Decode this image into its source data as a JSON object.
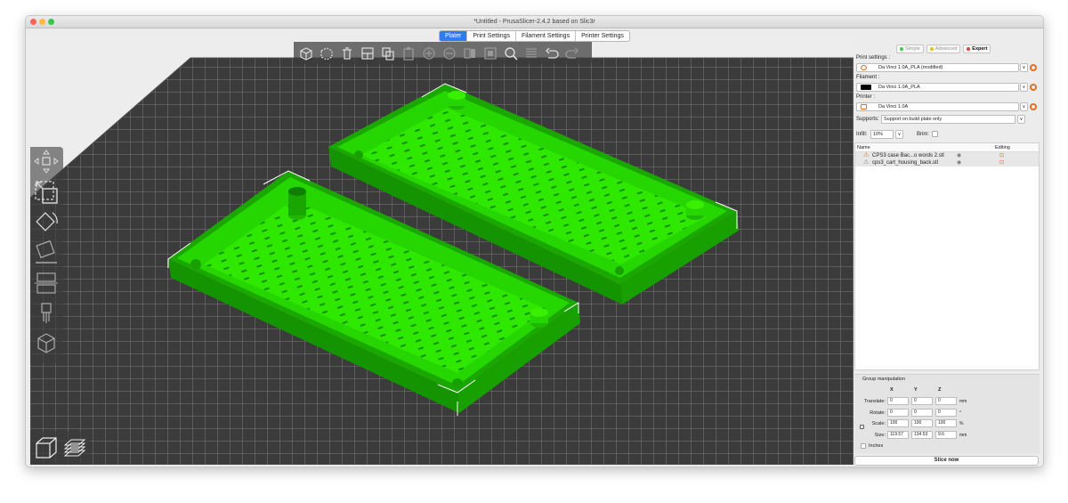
{
  "window": {
    "title": "*Untitled - PrusaSlicer-2.4.2 based on Slic3r"
  },
  "tabs": [
    "Plater",
    "Print Settings",
    "Filament Settings",
    "Printer Settings"
  ],
  "modes": {
    "simple": "Simple",
    "advanced": "Advanced",
    "expert": "Expert"
  },
  "print_settings": {
    "label": "Print settings :",
    "value": "Da Vinci 1.0A_PLA (modified)"
  },
  "filament": {
    "label": "Filament :",
    "value": "Da Vinci 1.0A_PLA"
  },
  "printer": {
    "label": "Printer :",
    "value": "Da Vinci 1.0A"
  },
  "supports": {
    "label": "Supports:",
    "value": "Support on build plate only"
  },
  "infill": {
    "label": "Infill:",
    "value": "10%"
  },
  "brim": {
    "label": "Brim:"
  },
  "object_list": {
    "col_name": "Name",
    "col_editing": "Editing",
    "objects": [
      {
        "name": "CPS3 case Bac...o words 2.stl"
      },
      {
        "name": "cps3_cart_housing_back.stl"
      }
    ]
  },
  "group_manipulation": {
    "title": "Group manipulation",
    "axes": [
      "X",
      "Y",
      "Z"
    ],
    "translate": {
      "label": "Translate:",
      "values": [
        "0",
        "0",
        "0"
      ],
      "unit": "mm"
    },
    "rotate": {
      "label": "Rotate:",
      "values": [
        "0",
        "0",
        "0"
      ],
      "unit": "°"
    },
    "scale": {
      "label": "Scale:",
      "values": [
        "100",
        "100",
        "100"
      ],
      "unit": "%"
    },
    "size": {
      "label": "Size:",
      "values": [
        "119.57",
        "134.53",
        "9.6"
      ],
      "unit": "mm"
    },
    "inches_label": "Inches"
  },
  "slice_button": "Slice now",
  "colors": {
    "accent": "#2f7bf5",
    "model_green": "#25d600",
    "bed": "#3d3d3d",
    "gear_orange": "#e36f23"
  }
}
